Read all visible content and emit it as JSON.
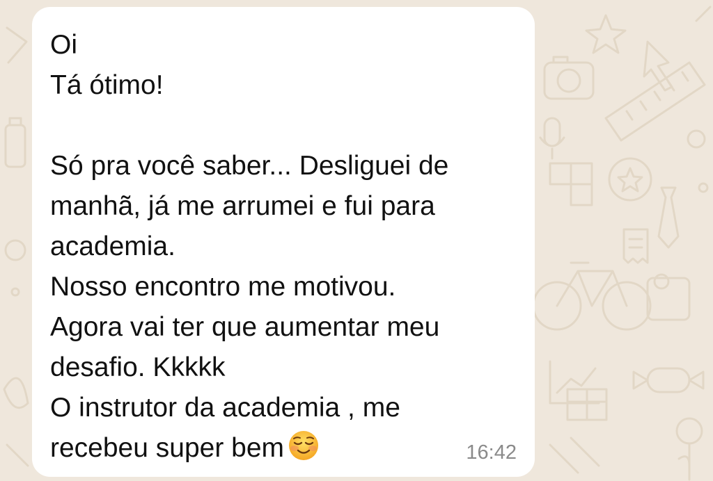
{
  "chat": {
    "background_color": "#efe7dc",
    "doodle_color": "#e2d7c6",
    "message": {
      "lines": [
        "Oi",
        "Tá ótimo!",
        "",
        "Só pra você saber... Desliguei de",
        "manhã, já me arrumei e fui para",
        "academia.",
        "Nosso encontro me motivou.",
        "Agora vai ter que aumentar meu",
        "desafio. Kkkkk",
        "O instrutor da academia , me",
        "recebeu super bem"
      ],
      "trailing_emoji": "smiling-face-icon",
      "time": "16:42",
      "bubble_color": "#ffffff",
      "text_color": "#111111",
      "time_color": "#8a8a8a"
    }
  }
}
